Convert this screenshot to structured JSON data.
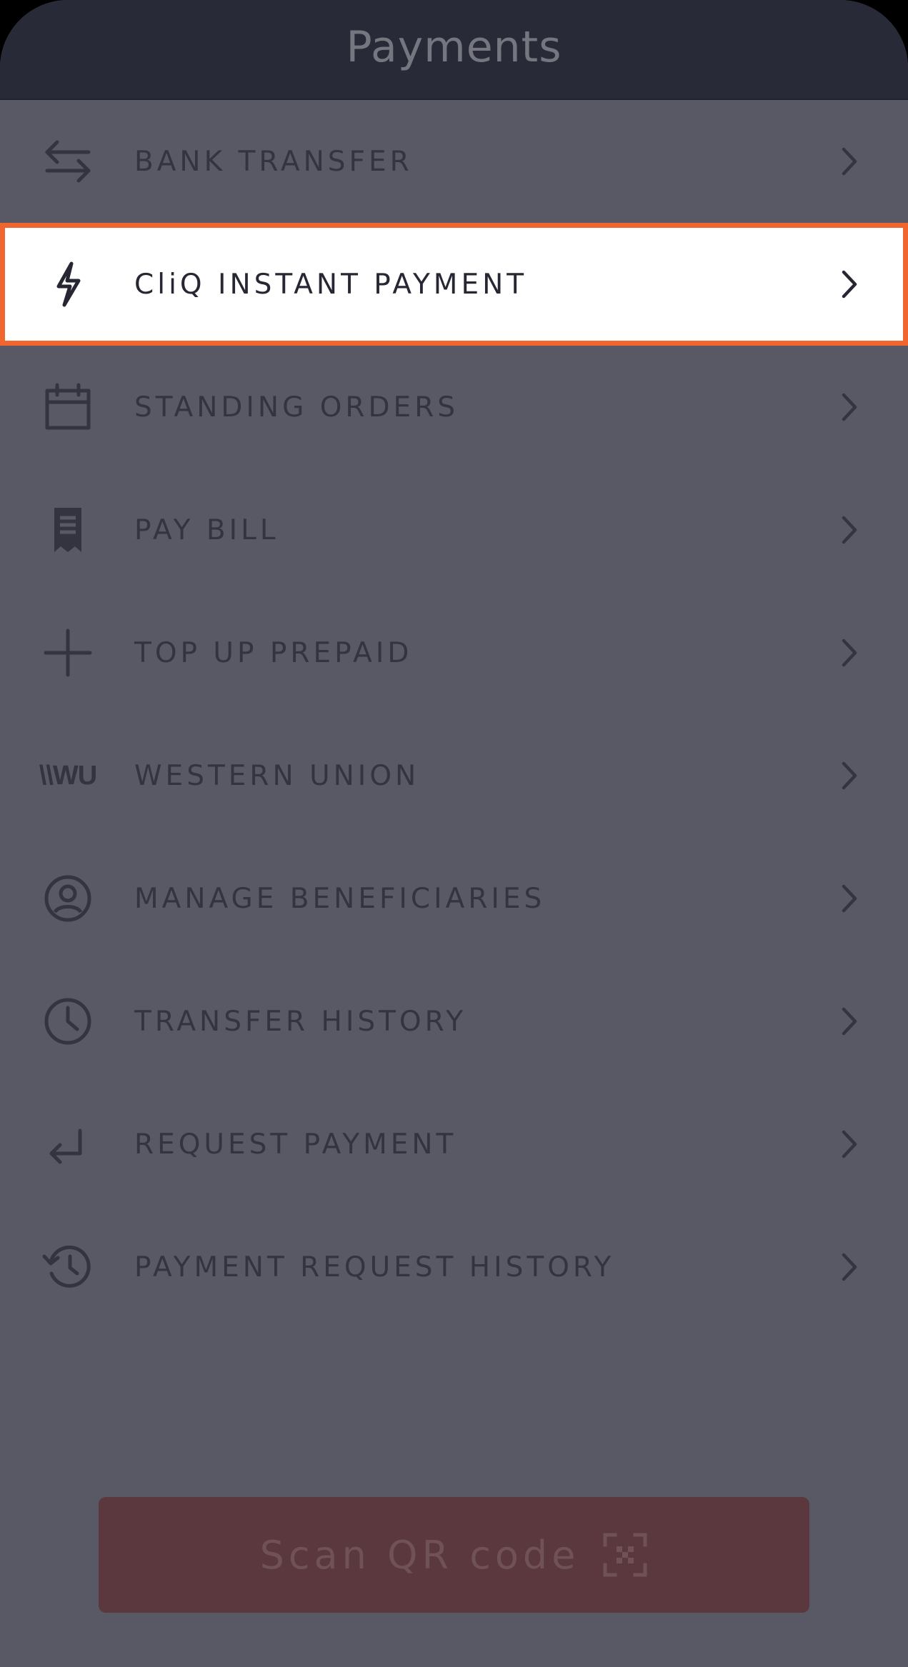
{
  "header": {
    "title": "Payments"
  },
  "menu": {
    "items": [
      {
        "label": "BANK TRANSFER",
        "icon": "transfer-arrows-icon"
      },
      {
        "label": "CliQ INSTANT PAYMENT",
        "icon": "lightning-icon",
        "highlighted": true
      },
      {
        "label": "STANDING ORDERS",
        "icon": "calendar-icon"
      },
      {
        "label": "PAY BILL",
        "icon": "receipt-icon"
      },
      {
        "label": "TOP UP PREPAID",
        "icon": "plus-icon"
      },
      {
        "label": "WESTERN UNION",
        "icon": "western-union-logo-icon",
        "icon_text": "\\\\WU"
      },
      {
        "label": "MANAGE BENEFICIARIES",
        "icon": "user-circle-icon"
      },
      {
        "label": "TRANSFER HISTORY",
        "icon": "clock-icon"
      },
      {
        "label": "REQUEST PAYMENT",
        "icon": "return-arrow-icon"
      },
      {
        "label": "PAYMENT REQUEST HISTORY",
        "icon": "history-icon"
      }
    ]
  },
  "scan_button": {
    "label": "Scan QR code",
    "icon": "qr-scan-icon"
  },
  "colors": {
    "header_bg": "#292a37",
    "body_bg": "#595965",
    "highlight_border": "#f1662e",
    "highlight_bg": "#ffffff",
    "scan_button_bg": "#5a383d"
  }
}
